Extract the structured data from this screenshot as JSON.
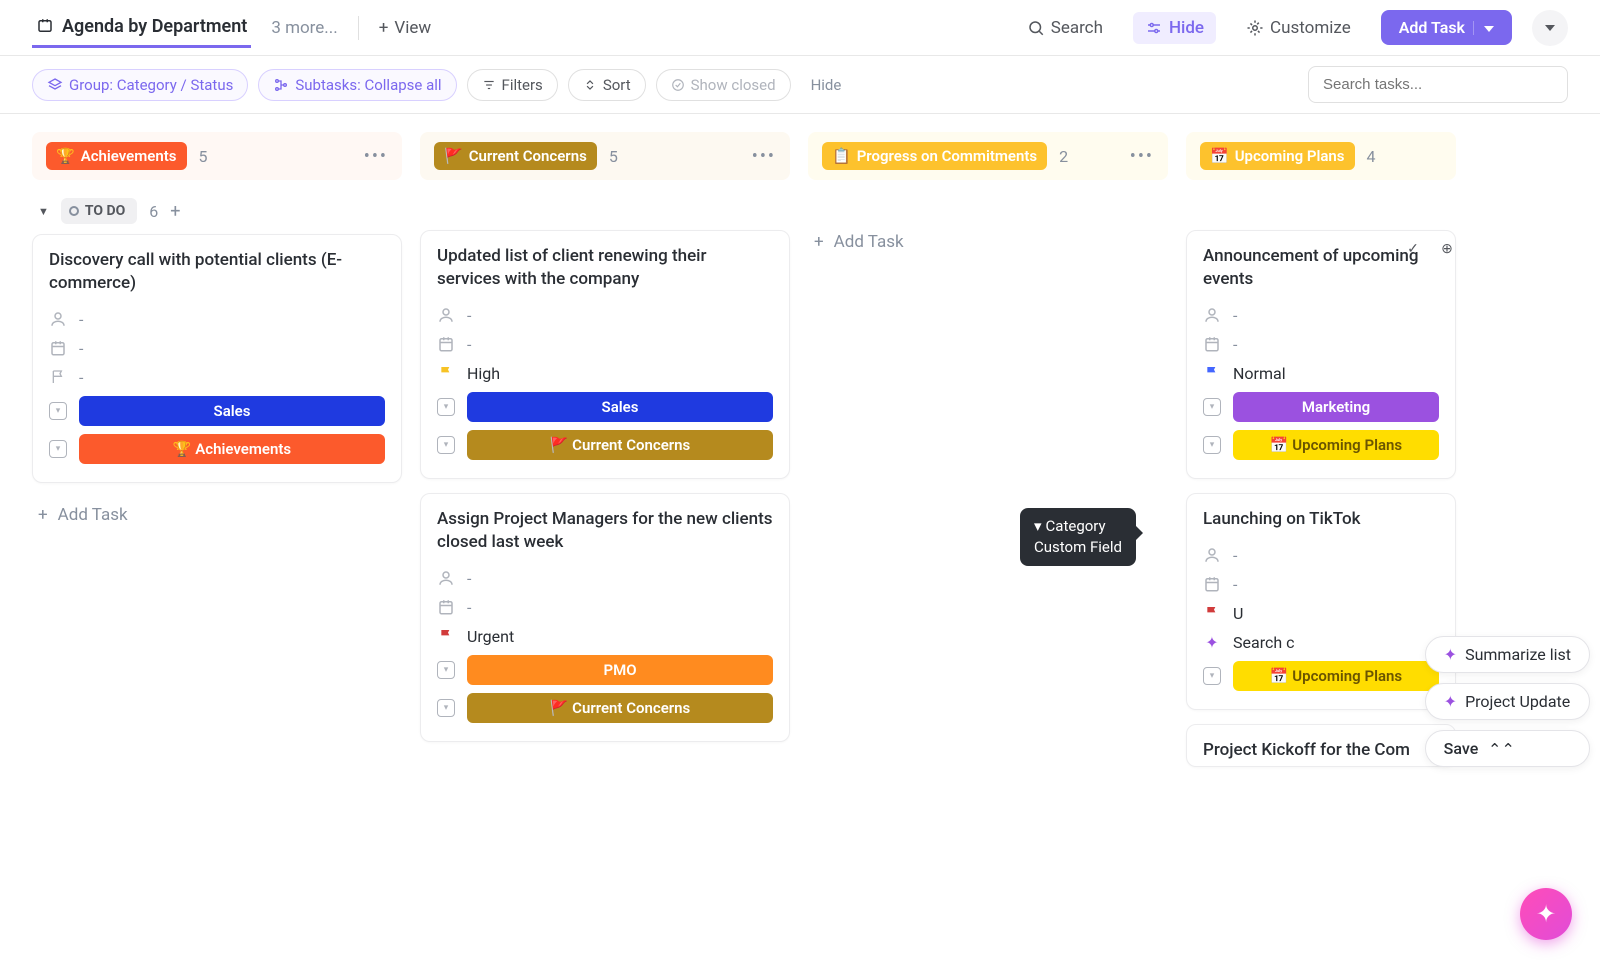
{
  "topbar": {
    "view_title": "Agenda by Department",
    "more_views": "3 more...",
    "view_btn": "View",
    "search": "Search",
    "hide": "Hide",
    "customize": "Customize",
    "add_task": "Add Task"
  },
  "toolbar": {
    "group": "Group: Category / Status",
    "subtasks": "Subtasks: Collapse all",
    "filters": "Filters",
    "sort": "Sort",
    "show_closed": "Show closed",
    "hide": "Hide",
    "search_placeholder": "Search tasks..."
  },
  "columns": [
    {
      "emoji": "🏆",
      "label": "Achievements",
      "count": "5",
      "bg": "b-orange"
    },
    {
      "emoji": "🚩",
      "label": "Current Concerns",
      "count": "5",
      "bg": "b-brown"
    },
    {
      "emoji": "📋",
      "label": "Progress on Commitments",
      "count": "2",
      "bg": "b-gold"
    },
    {
      "emoji": "📅",
      "label": "Upcoming Plans",
      "count": "4",
      "bg": "b-gold"
    }
  ],
  "status": {
    "label": "TO DO",
    "count": "6"
  },
  "cards": {
    "c1": {
      "title": "Discovery call with potential clients (E-commerce)",
      "assignee": "-",
      "date": "-",
      "priority": "-",
      "dept": "Sales",
      "dept_bg": "bg-blue",
      "cat": "🏆 Achievements",
      "cat_bg": "bg-orange"
    },
    "c2a": {
      "title": "Updated list of client renewing their services with the company",
      "assignee": "-",
      "date": "-",
      "priority": "High",
      "priority_cls": "flag-y",
      "dept": "Sales",
      "dept_bg": "bg-blue",
      "cat": "🚩 Current Concerns",
      "cat_bg": "bg-brown"
    },
    "c2b": {
      "title": "Assign Project Managers for the new clients closed last week",
      "assignee": "-",
      "date": "-",
      "priority": "Urgent",
      "priority_cls": "flag-r",
      "dept": "PMO",
      "dept_bg": "bg-orange2",
      "cat": "🚩 Current Concerns",
      "cat_bg": "bg-brown"
    },
    "c4a": {
      "title": "Announcement of upcoming events",
      "assignee": "-",
      "date": "-",
      "priority": "Normal",
      "priority_cls": "flag-b",
      "dept": "Marketing",
      "dept_bg": "bg-purple",
      "cat": "📅 Upcoming Plans",
      "cat_bg": "bg-yellow"
    },
    "c4b": {
      "title": "Launching on TikTok",
      "assignee": "-",
      "date": "-",
      "priority": "U",
      "priority_cls": "flag-r",
      "search_chip": "Search c",
      "cat": "📅 Upcoming Plans",
      "cat_bg": "bg-yellow"
    },
    "c4c": {
      "title": "Project Kickoff for the Com"
    }
  },
  "add_task_link": "Add Task",
  "tooltip": {
    "line1": "Category",
    "line2": "Custom Field"
  },
  "chips": {
    "summarize": "Summarize list",
    "update": "Project Update",
    "save": "Save"
  }
}
